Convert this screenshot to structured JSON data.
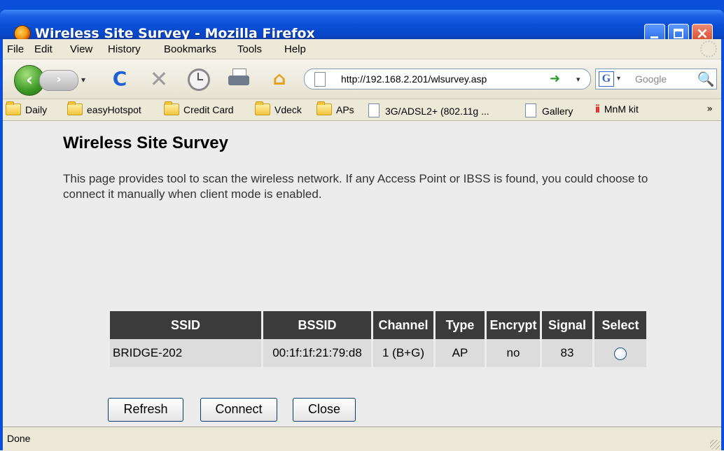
{
  "window": {
    "title": "Wireless Site Survey - Mozilla Firefox",
    "buttons": {
      "minimize": "minimize",
      "maximize": "maximize",
      "close": "×"
    }
  },
  "menubar": [
    {
      "label": "File"
    },
    {
      "label": "Edit"
    },
    {
      "label": "View"
    },
    {
      "label": "History"
    },
    {
      "label": "Bookmarks"
    },
    {
      "label": "Tools"
    },
    {
      "label": "Help"
    }
  ],
  "navbar": {
    "back_glyph": "‹",
    "forward_glyph": "›",
    "dropdown_glyph": "▾",
    "reload_glyph": "C",
    "stop_glyph": "✕",
    "home_glyph": "⌂",
    "url": "http://192.168.2.201/wlsurvey.asp",
    "go_glyph": "➜",
    "search_placeholder": "Google",
    "search_engine_glyph": "G",
    "search_button_glyph": "🔍"
  },
  "bookmarks": [
    {
      "label": "Daily",
      "kind": "folder"
    },
    {
      "label": "easyHotspot",
      "kind": "folder"
    },
    {
      "label": "Credit Card",
      "kind": "folder"
    },
    {
      "label": "Vdeck",
      "kind": "folder"
    },
    {
      "label": "APs",
      "kind": "folder"
    },
    {
      "label": "3G/ADSL2+ (802.11g ...",
      "kind": "page"
    },
    {
      "label": "Gallery",
      "kind": "page"
    },
    {
      "label": "MnM kit",
      "kind": "app"
    }
  ],
  "bookmarks_overflow": "»",
  "page": {
    "heading": "Wireless Site Survey",
    "description": "This page provides tool to scan the wireless network. If any Access Point or IBSS is found, you could choose to connect it manually when client mode is enabled.",
    "table": {
      "headers": [
        "SSID",
        "BSSID",
        "Channel",
        "Type",
        "Encrypt",
        "Signal",
        "Select"
      ],
      "rows": [
        {
          "ssid": "BRIDGE-202",
          "bssid": "00:1f:1f:21:79:d8",
          "channel": "1 (B+G)",
          "type": "AP",
          "encrypt": "no",
          "signal": "83",
          "selected": false
        }
      ]
    },
    "buttons": {
      "refresh": "Refresh",
      "connect": "Connect",
      "close": "Close"
    }
  },
  "statusbar": {
    "text": "Done"
  },
  "colors": {
    "titlebar": "#0a4fd8",
    "table_header": "#3b3b3b",
    "table_cell": "#dcdcdc",
    "content_bg": "#ececec"
  }
}
